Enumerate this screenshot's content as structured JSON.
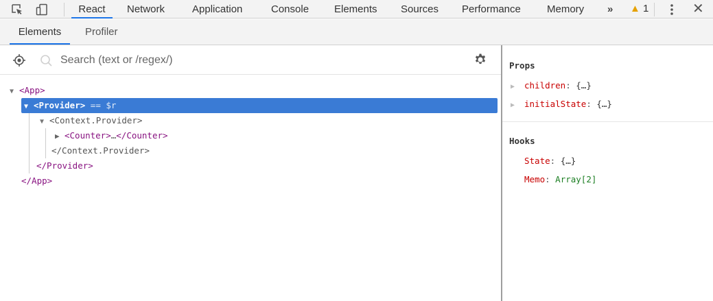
{
  "toolbar": {
    "tabs": [
      "React",
      "Network",
      "Application",
      "Console",
      "Elements",
      "Sources",
      "Performance",
      "Memory"
    ],
    "more_label": "»",
    "warning_count": "1",
    "close_label": "✕"
  },
  "subtabs": [
    "Elements",
    "Profiler"
  ],
  "search": {
    "placeholder": "Search (text or /regex/)"
  },
  "tree": {
    "app_open": "<App>",
    "provider_open": "<Provider>",
    "provider_suffix": "== $r",
    "context_open": "<Context.Provider>",
    "counter_open": "<Counter>",
    "counter_ellipsis": "…",
    "counter_close": "</Counter>",
    "context_close": "</Context.Provider>",
    "provider_close": "</Provider>",
    "app_close": "</App>"
  },
  "props": {
    "title": "Props",
    "items": [
      {
        "key": "children",
        "value": "{…}"
      },
      {
        "key": "initialState",
        "value": "{…}"
      }
    ]
  },
  "hooks": {
    "title": "Hooks",
    "items": [
      {
        "key": "State",
        "value": "{…}"
      },
      {
        "key": "Memo",
        "value": "Array[2]"
      }
    ]
  },
  "colors": {
    "accent": "#1a73e8",
    "selection": "#3a7bd5",
    "tag": "#881280",
    "prop_key": "#c80000",
    "warning": "#e5a100"
  }
}
